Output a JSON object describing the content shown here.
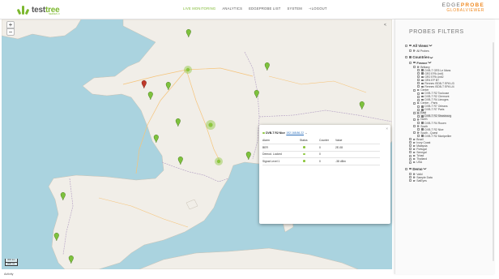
{
  "app": {
    "logo_text": "test",
    "logo_accent": "tree",
    "logo_sub": "SERIES 3",
    "brand_line1": "EDGE",
    "brand_line1_accent": "PROBE",
    "brand_line2": "GLOBALVIEWER"
  },
  "nav": {
    "items": [
      {
        "label": "LIVE MONITORING",
        "active": true
      },
      {
        "label": "ANALYTICS",
        "active": false
      },
      {
        "label": "EDGEPROBE LIST",
        "active": false
      },
      {
        "label": "SYSTEM",
        "active": false
      },
      {
        "label": "LOGOUT",
        "active": false
      }
    ]
  },
  "map": {
    "zoom_in": "+",
    "zoom_out": "−",
    "scale_km": "300 km",
    "scale_mi": "200 mi",
    "markers": [
      {
        "status": "green",
        "lat": 48.8,
        "lon": 2.4
      },
      {
        "status": "red",
        "lat": 47.4,
        "lon": -1.8
      },
      {
        "status": "green",
        "lat": 47.0,
        "lon": -0.9
      }
    ]
  },
  "popup": {
    "probe_name": "DVB-T R2 Nice",
    "probe_ip": "192.168.86.22",
    "expand_icon": "chevron-down-icon",
    "close_label": "×",
    "columns": [
      "Alarm",
      "Status",
      "Counter",
      "Value"
    ],
    "rows": [
      {
        "alarm": "BER",
        "status": "ok",
        "counter": "0",
        "value": "2E-08"
      },
      {
        "alarm": "Demod. Locked",
        "status": "ok",
        "counter": "0",
        "value": ""
      },
      {
        "alarm": "Signal Level 1",
        "status": "ok",
        "counter": "0",
        "value": "-38 dBm"
      }
    ]
  },
  "filters": {
    "collapse_label": "<",
    "title": "PROBES FILTERS",
    "tree": [
      {
        "label": "All Views",
        "level": 0,
        "kind": "h1",
        "icon": "folder"
      },
      {
        "label": "All Probes",
        "level": 1,
        "kind": "leaf",
        "icon": "tag"
      },
      {
        "label": "Countries",
        "level": 0,
        "kind": "h1",
        "icon": "folder"
      },
      {
        "label": "France",
        "level": 1,
        "kind": "h2",
        "icon": "folder"
      },
      {
        "label": "Brittany",
        "level": 2,
        "kind": "leaf",
        "icon": "tag"
      },
      {
        "label": "DVB-T GR3 Le Mans",
        "level": 3,
        "kind": "leaf",
        "icon": "folder"
      },
      {
        "label": "GR2 EPA Unit1",
        "level": 3,
        "kind": "leaf",
        "icon": "folder"
      },
      {
        "label": "GR2 EPA Unit2",
        "level": 3,
        "kind": "leaf",
        "icon": "folder"
      },
      {
        "label": "GR4 EP BT",
        "level": 3,
        "kind": "leaf",
        "icon": "folder"
      },
      {
        "label": "Rennes ISDB-T EPA U3",
        "level": 3,
        "kind": "leaf",
        "icon": "folder"
      },
      {
        "label": "Rennes ISDB-T EPA U4",
        "level": 3,
        "kind": "leaf",
        "icon": "folder"
      },
      {
        "label": "Center",
        "level": 2,
        "kind": "leaf",
        "icon": "tag"
      },
      {
        "label": "DVB-T R2 Toulouse",
        "level": 3,
        "kind": "leaf",
        "icon": "folder"
      },
      {
        "label": "DVB-T R2 Clermont",
        "level": 3,
        "kind": "leaf",
        "icon": "folder"
      },
      {
        "label": "DVB-T R4 Limoges",
        "level": 3,
        "kind": "leaf",
        "icon": "folder"
      },
      {
        "label": "Center - Paris",
        "level": 2,
        "kind": "leaf",
        "icon": "tag"
      },
      {
        "label": "DVB-T R7 Orleans",
        "level": 3,
        "kind": "leaf",
        "icon": "folder"
      },
      {
        "label": "DVB-T R7 Paris",
        "level": 3,
        "kind": "leaf",
        "icon": "folder"
      },
      {
        "label": "East",
        "level": 2,
        "kind": "leaf",
        "icon": "tag",
        "selected": true
      },
      {
        "label": "DVB-T R2 Strasbourg",
        "level": 3,
        "kind": "leaf",
        "icon": "folder",
        "selected": true
      },
      {
        "label": "North",
        "level": 2,
        "kind": "leaf",
        "icon": "tag"
      },
      {
        "label": "DVB-T R4 Rouen",
        "level": 3,
        "kind": "leaf",
        "icon": "folder"
      },
      {
        "label": "South",
        "level": 2,
        "kind": "leaf",
        "icon": "tag"
      },
      {
        "label": "DVB-T R2 Nice",
        "level": 3,
        "kind": "leaf",
        "icon": "folder"
      },
      {
        "label": "South - Quest",
        "level": 2,
        "kind": "leaf",
        "icon": "tag"
      },
      {
        "label": "DVB-T R2 Montpellier",
        "level": 3,
        "kind": "leaf",
        "icon": "folder"
      },
      {
        "label": "Brazil",
        "level": 1,
        "kind": "leaf",
        "icon": "tag"
      },
      {
        "label": "Ivory Coast",
        "level": 1,
        "kind": "leaf",
        "icon": "tag"
      },
      {
        "label": "Malaysia",
        "level": 1,
        "kind": "leaf",
        "icon": "tag"
      },
      {
        "label": "Portugal",
        "level": 1,
        "kind": "leaf",
        "icon": "tag"
      },
      {
        "label": "Senegal",
        "level": 1,
        "kind": "leaf",
        "icon": "tag"
      },
      {
        "label": "Tchad",
        "level": 1,
        "kind": "leaf",
        "icon": "tag"
      },
      {
        "label": "Thailand",
        "level": 1,
        "kind": "leaf",
        "icon": "tag"
      },
      {
        "label": "USA",
        "level": 1,
        "kind": "leaf",
        "icon": "tag"
      },
      {
        "label": "Demo",
        "level": 0,
        "kind": "h1",
        "icon": "folder"
      },
      {
        "label": "Valid",
        "level": 1,
        "kind": "leaf",
        "icon": "tag"
      },
      {
        "label": "Sample Data",
        "level": 1,
        "kind": "leaf",
        "icon": "tag"
      },
      {
        "label": "SatEyes",
        "level": 1,
        "kind": "leaf",
        "icon": "tag"
      }
    ]
  },
  "footer": {
    "activity_label": "Activity"
  },
  "colors": {
    "accent_green": "#7cb82f",
    "brand_orange": "#f08a22",
    "status_ok": "#8dc63f",
    "status_alarm": "#c0392b",
    "sea": "#aad3df",
    "land": "#f1eee8"
  }
}
